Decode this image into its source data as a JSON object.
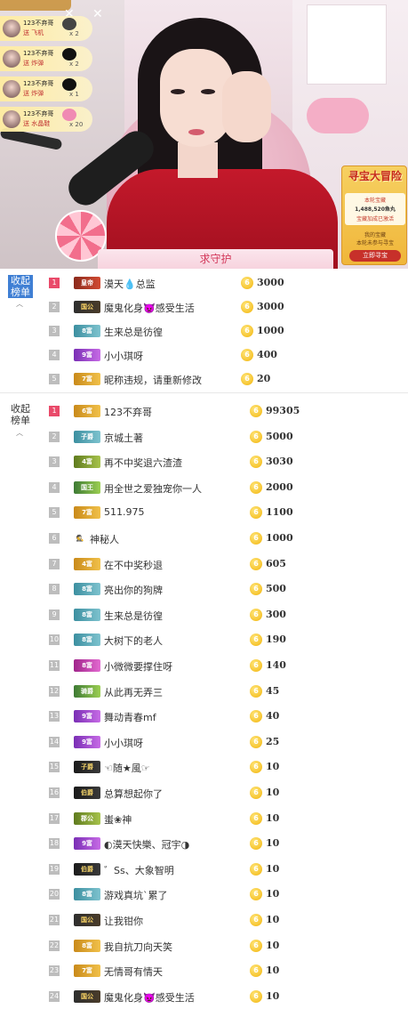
{
  "gift_feed": [
    {
      "user": "123不弃哥",
      "gift": "送 飞机",
      "count": "x 2"
    },
    {
      "user": "123不弃哥",
      "gift": "送 炸弹",
      "count": "x 2"
    },
    {
      "user": "123不弃哥",
      "gift": "送 炸弹",
      "count": "x 1"
    },
    {
      "user": "123不弃哥",
      "gift": "送 水晶鞋",
      "count": "x 20"
    }
  ],
  "treasure": {
    "title": "寻宝大冒险",
    "line1": "本轮宝藏",
    "amount": "1,488,520鱼丸",
    "line2": "宝藏加成已激活",
    "line3": "我的宝藏",
    "line4": "本轮未参与寻宝",
    "button": "立即寻宝"
  },
  "guard_button": "求守护",
  "panel1": {
    "collapse_label": "收起榜单",
    "rows": [
      {
        "rank": "1",
        "badge": "皇帝",
        "badge_style": "b-red",
        "nick": "漠天💧总监",
        "value": "3000"
      },
      {
        "rank": "2",
        "badge": "国公",
        "badge_style": "b-dark",
        "nick": "魔鬼化身👿感受生活",
        "value": "3000"
      },
      {
        "rank": "3",
        "badge": "8富",
        "badge_style": "b-teal",
        "nick": "生来总是彷徨",
        "value": "1000"
      },
      {
        "rank": "4",
        "badge": "9富",
        "badge_style": "b-purple",
        "nick": "小小琪呀",
        "value": "400"
      },
      {
        "rank": "5",
        "badge": "7富",
        "badge_style": "b-gold",
        "nick": "昵称违规，请重新修改",
        "value": "20"
      }
    ]
  },
  "panel2": {
    "collapse_label": "收起榜单",
    "rows": [
      {
        "rank": "1",
        "badge": "6富",
        "badge_style": "b-gold",
        "nick": "123不弃哥",
        "value": "99305"
      },
      {
        "rank": "2",
        "badge": "子爵",
        "badge_style": "b-teal",
        "nick": "京城土著",
        "value": "5000"
      },
      {
        "rank": "3",
        "badge": "4富",
        "badge_style": "b-olive",
        "nick": "再不中奖退六渣渣",
        "value": "3030"
      },
      {
        "rank": "4",
        "badge": "国王",
        "badge_style": "b-green",
        "nick": "用全世之爱独宠你一人",
        "value": "2000"
      },
      {
        "rank": "5",
        "badge": "7富",
        "badge_style": "b-gold",
        "nick": "511.975",
        "value": "1100"
      },
      {
        "rank": "6",
        "badge": "🕵",
        "badge_style": "b-none",
        "nick": "神秘人",
        "value": "1000"
      },
      {
        "rank": "7",
        "badge": "4富",
        "badge_style": "b-gold",
        "nick": "在不中奖秒退",
        "value": "605"
      },
      {
        "rank": "8",
        "badge": "8富",
        "badge_style": "b-teal",
        "nick": "亮出你的狗牌",
        "value": "500"
      },
      {
        "rank": "9",
        "badge": "8富",
        "badge_style": "b-teal",
        "nick": "生来总是彷徨",
        "value": "300"
      },
      {
        "rank": "10",
        "badge": "8富",
        "badge_style": "b-teal",
        "nick": "大树下的老人",
        "value": "190"
      },
      {
        "rank": "11",
        "badge": "8富",
        "badge_style": "b-mag",
        "nick": "小微微要撑住呀",
        "value": "140"
      },
      {
        "rank": "12",
        "badge": "骑爵",
        "badge_style": "b-green",
        "nick": "从此再无弄三",
        "value": "45"
      },
      {
        "rank": "13",
        "badge": "9富",
        "badge_style": "b-purple",
        "nick": "舞动青春mf",
        "value": "40"
      },
      {
        "rank": "14",
        "badge": "9富",
        "badge_style": "b-purple",
        "nick": "小小琪呀",
        "value": "25"
      },
      {
        "rank": "15",
        "badge": "子爵",
        "badge_style": "b-black",
        "nick": "☜随★風☞",
        "value": "10"
      },
      {
        "rank": "16",
        "badge": "伯爵",
        "badge_style": "b-black",
        "nick": "总算想起你了",
        "value": "10"
      },
      {
        "rank": "17",
        "badge": "郡公",
        "badge_style": "b-olive",
        "nick": "蚩❀神",
        "value": "10"
      },
      {
        "rank": "18",
        "badge": "9富",
        "badge_style": "b-purple",
        "nick": "◐漠天快樂、冠宇◑",
        "value": "10"
      },
      {
        "rank": "19",
        "badge": "伯爵",
        "badge_style": "b-black",
        "nick": "゛Ss、大象智明",
        "value": "10"
      },
      {
        "rank": "20",
        "badge": "8富",
        "badge_style": "b-teal",
        "nick": "游戏真坑`累了",
        "value": "10"
      },
      {
        "rank": "21",
        "badge": "国公",
        "badge_style": "b-dark",
        "nick": "让我钳你",
        "value": "10"
      },
      {
        "rank": "22",
        "badge": "8富",
        "badge_style": "b-gold",
        "nick": "我自抗刀向天笑",
        "value": "10"
      },
      {
        "rank": "23",
        "badge": "7富",
        "badge_style": "b-gold",
        "nick": "无情哥有情天",
        "value": "10"
      },
      {
        "rank": "24",
        "badge": "国公",
        "badge_style": "b-dark",
        "nick": "魔鬼化身👿感受生活",
        "value": "10"
      }
    ]
  }
}
